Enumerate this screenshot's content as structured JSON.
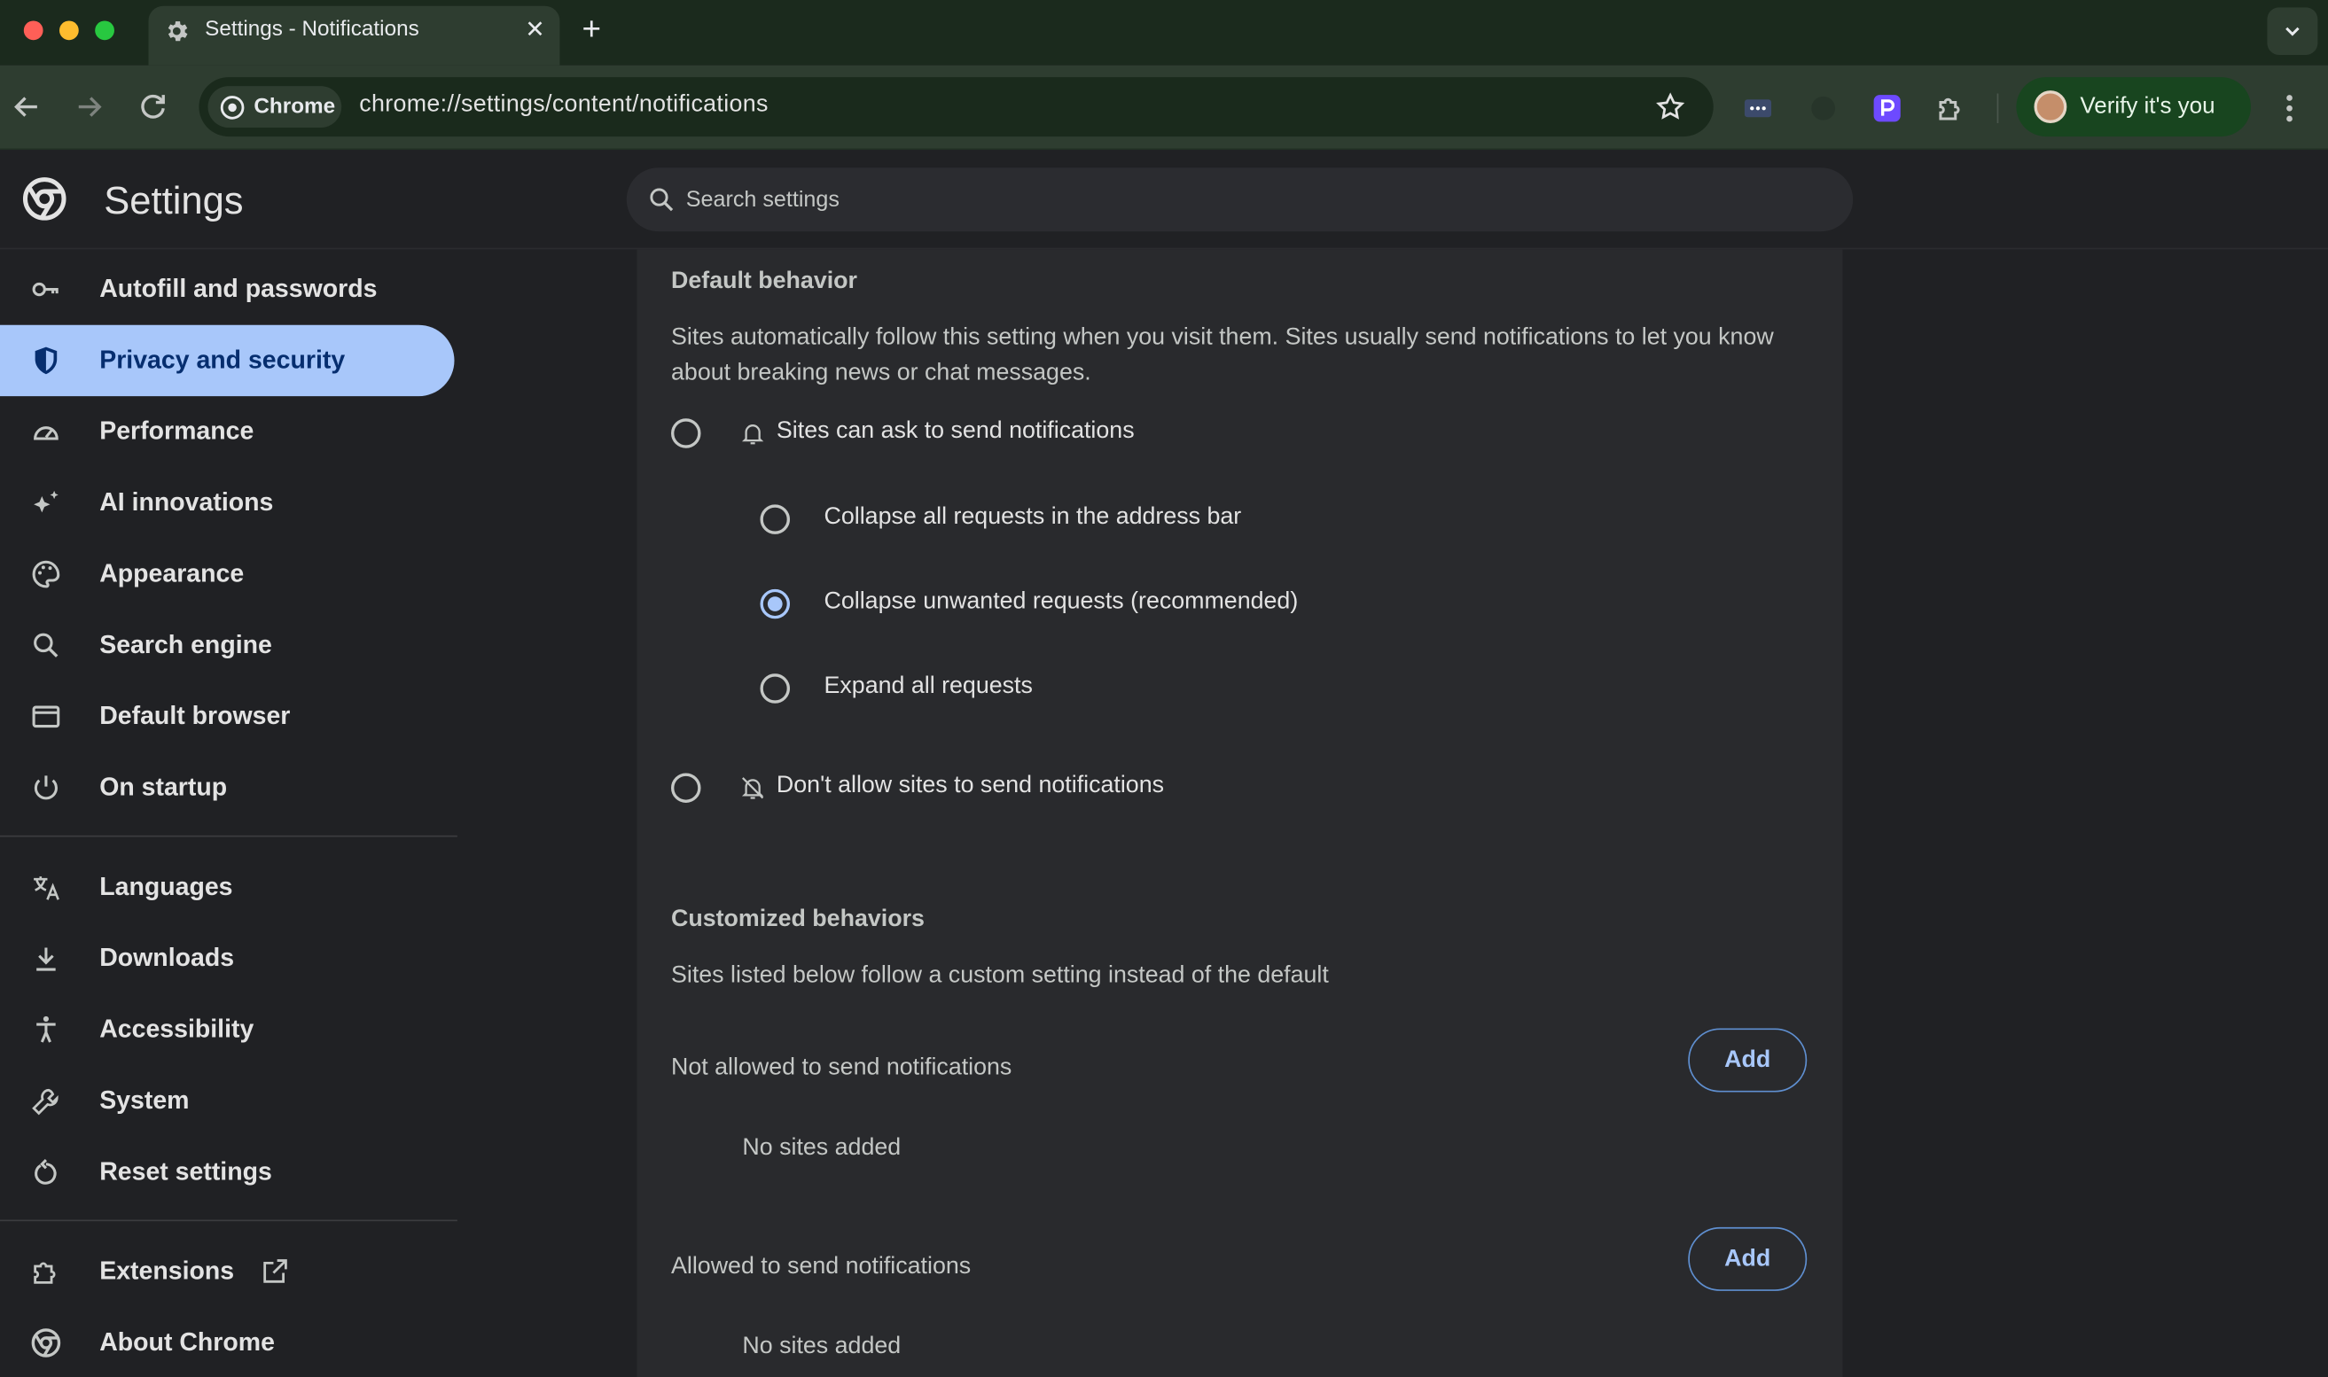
{
  "browser": {
    "tab_title": "Settings - Notifications",
    "tab_close": "✕",
    "new_tab": "+",
    "chip_label": "Chrome",
    "url": "chrome://settings/content/notifications",
    "verify_label": "Verify it's you"
  },
  "header": {
    "title": "Settings",
    "search_placeholder": "Search settings"
  },
  "sidebar": {
    "items": [
      {
        "label": "Autofill and passwords",
        "icon": "key-icon"
      },
      {
        "label": "Privacy and security",
        "icon": "shield-icon",
        "active": true
      },
      {
        "label": "Performance",
        "icon": "gauge-icon"
      },
      {
        "label": "AI innovations",
        "icon": "sparkle-icon"
      },
      {
        "label": "Appearance",
        "icon": "palette-icon"
      },
      {
        "label": "Search engine",
        "icon": "search-icon"
      },
      {
        "label": "Default browser",
        "icon": "browser-window-icon"
      },
      {
        "label": "On startup",
        "icon": "power-icon"
      },
      {
        "label": "Languages",
        "icon": "translate-icon"
      },
      {
        "label": "Downloads",
        "icon": "download-icon"
      },
      {
        "label": "Accessibility",
        "icon": "accessibility-icon"
      },
      {
        "label": "System",
        "icon": "wrench-icon"
      },
      {
        "label": "Reset settings",
        "icon": "reset-icon"
      },
      {
        "label": "Extensions",
        "icon": "puzzle-icon"
      },
      {
        "label": "About Chrome",
        "icon": "chrome-icon"
      }
    ]
  },
  "main": {
    "default_title": "Default behavior",
    "default_desc_1": "Sites automatically follow this setting when you visit them. Sites usually send notifications to let you know",
    "default_desc_2": "about breaking news or chat messages.",
    "options": {
      "ask": "Sites can ask to send notifications",
      "collapse_all": "Collapse all requests in the address bar",
      "collapse_unwanted": "Collapse unwanted requests (recommended)",
      "expand_all": "Expand all requests",
      "block": "Don't allow sites to send notifications"
    },
    "selected_option": "collapse_unwanted",
    "custom_title": "Customized behaviors",
    "custom_desc": "Sites listed below follow a custom setting instead of the default",
    "not_allowed_label": "Not allowed to send notifications",
    "allowed_label": "Allowed to send notifications",
    "add_label": "Add",
    "empty_label": "No sites added"
  },
  "colors": {
    "accent": "#a8c7fa",
    "background": "#202124",
    "card": "#292a2d",
    "toolbar": "#2e3d30"
  }
}
